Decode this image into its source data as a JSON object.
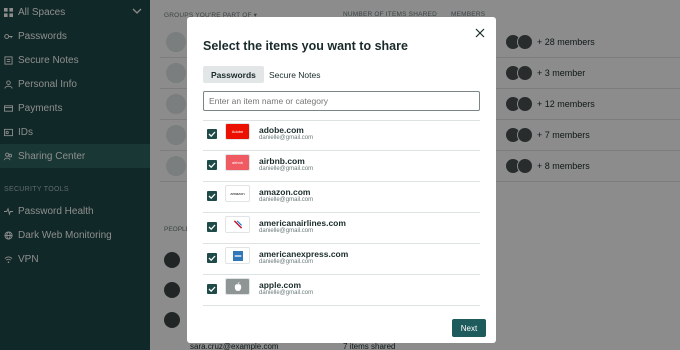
{
  "sidebar": {
    "items": [
      {
        "label": "All Spaces",
        "icon": "grid-icon"
      },
      {
        "label": "Passwords",
        "icon": "key-icon"
      },
      {
        "label": "Secure Notes",
        "icon": "note-icon"
      },
      {
        "label": "Personal Info",
        "icon": "person-icon"
      },
      {
        "label": "Payments",
        "icon": "card-icon"
      },
      {
        "label": "IDs",
        "icon": "id-icon"
      },
      {
        "label": "Sharing Center",
        "icon": "share-icon"
      }
    ],
    "security_heading": "SECURITY TOOLS",
    "security_items": [
      {
        "label": "Password Health",
        "icon": "pulse-icon"
      },
      {
        "label": "Dark Web Monitoring",
        "icon": "globe-icon"
      },
      {
        "label": "VPN",
        "icon": "wifi-icon"
      }
    ]
  },
  "main": {
    "col_groups": "GROUPS YOU'RE PART OF ▾",
    "col_items": "NUMBER OF ITEMS SHARED",
    "col_members": "MEMBERS",
    "groups": [
      {
        "members": "+ 28 members"
      },
      {
        "members": "+ 3 member"
      },
      {
        "members": "+ 12 members"
      },
      {
        "members": "+ 7 members"
      },
      {
        "members": "+ 8 members"
      }
    ],
    "people_heading": "PEOPLE",
    "bottom_email": "sara.cruz@example.com",
    "bottom_shared": "7 items shared"
  },
  "modal": {
    "title": "Select the items you want to share",
    "tabs": [
      "Passwords",
      "Secure Notes"
    ],
    "search_placeholder": "Enter an item name or category",
    "items": [
      {
        "name": "adobe.com",
        "email": "danielle@gmail.com",
        "logo_text": "Adobe",
        "logo_bg": "#eb1000",
        "checked": true
      },
      {
        "name": "airbnb.com",
        "email": "danielle@gmail.com",
        "logo_text": "airbnb",
        "logo_bg": "#f05a62",
        "checked": true
      },
      {
        "name": "amazon.com",
        "email": "danielle@gmail.com",
        "logo_text": "amazon",
        "logo_bg": "#ffffff",
        "checked": true
      },
      {
        "name": "americanairlines.com",
        "email": "danielle@gmail.com",
        "logo_text": "",
        "logo_bg": "#ffffff",
        "checked": true
      },
      {
        "name": "americanexpress.com",
        "email": "danielle@gmail.com",
        "logo_text": "",
        "logo_bg": "#ffffff",
        "checked": true
      },
      {
        "name": "apple.com",
        "email": "danielle@gmail.com",
        "logo_text": "",
        "logo_bg": "#8f9494",
        "checked": true
      }
    ],
    "next_label": "Next"
  },
  "colors": {
    "sidebar": "#1e4a48",
    "accent": "#1e5b5c"
  }
}
